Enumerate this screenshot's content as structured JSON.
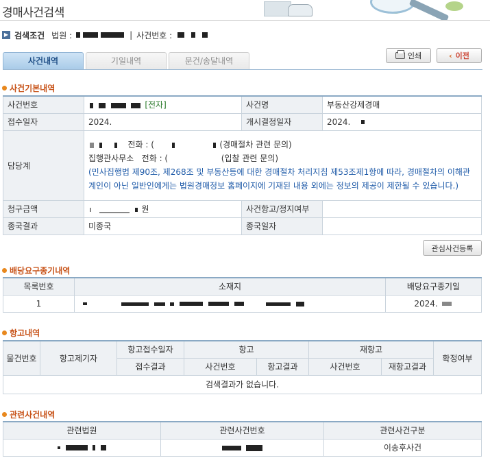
{
  "page": {
    "title": "경매사건검색"
  },
  "search_condition": {
    "label": "검색조건",
    "court_label": "법원 :",
    "separator": "|",
    "case_no_label": "사건번호 :"
  },
  "tabs": [
    {
      "label": "사건내역",
      "active": true
    },
    {
      "label": "기일내역",
      "active": false
    },
    {
      "label": "문건/송달내역",
      "active": false
    }
  ],
  "buttons": {
    "print": "인쇄",
    "prev": "이전",
    "interest": "관심사건등록"
  },
  "colors": {
    "section_title": "#c8541a",
    "tab_active": "#1f4e86",
    "note_blue": "#1e5aa8"
  },
  "basic_info": {
    "section_title": "사건기본내역",
    "case_no_label": "사건번호",
    "case_no_tag": "[전자]",
    "case_name_label": "사건명",
    "case_name": "부동산강제경매",
    "receipt_date_label": "접수일자",
    "receipt_date": "2024.",
    "start_date_label": "개시결정일자",
    "start_date": "2024.",
    "manager_label": "담당계",
    "manager_line1_phone": "전화 : (",
    "manager_line1_note": "(경매절차 관련 문의)",
    "manager_line2": "집행관사무소   전화 : (",
    "manager_line2_note": "(입찰 관련 문의)",
    "manager_notice": "(민사집행법 제90조, 제268조 및 부동산등에 대한 경매절차 처리지침 제53조제1항에 따라, 경매절차의 이해관계인이 아닌 일반인에게는 법원경매정보 홈페이지에 기재된 내용 외에는 정보의 제공이 제한될 수 있습니다.)",
    "claim_label": "청구금액",
    "claim_suffix": "원",
    "appeal_stop_label": "사건항고/정지여부",
    "result_label": "종국결과",
    "result": "미종국",
    "result_date_label": "종국일자"
  },
  "dividend": {
    "section_title": "배당요구종기내역",
    "headers": [
      "목록번호",
      "소재지",
      "배당요구종기일"
    ],
    "rows": [
      {
        "no": "1",
        "date": "2024."
      }
    ]
  },
  "appeal": {
    "section_title": "항고내역",
    "h_item_no": "물건번호",
    "h_appellant": "항고제기자",
    "h_receipt_date": "항고접수일자",
    "h_appeal": "항고",
    "h_reappeal": "재항고",
    "h_confirm": "확정여부",
    "h_receipt_result": "접수결과",
    "h_case_no": "사건번호",
    "h_appeal_result": "항고결과",
    "h_re_case_no": "사건번호",
    "h_reappeal_result": "재항고결과",
    "empty": "검색결과가 없습니다."
  },
  "related": {
    "section_title": "관련사건내역",
    "headers": [
      "관련법원",
      "관련사건번호",
      "관련사건구분"
    ],
    "rows": [
      {
        "type": "이송후사건"
      }
    ]
  }
}
